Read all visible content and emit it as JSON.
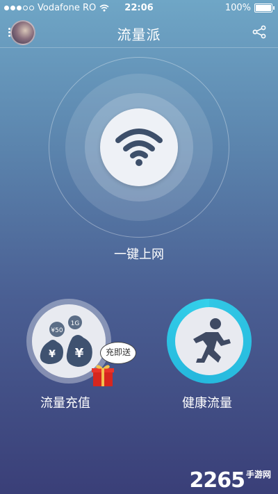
{
  "status": {
    "carrier": "Vodafone RO",
    "time": "22:06",
    "battery": "100%"
  },
  "nav": {
    "title": "流量派"
  },
  "main": {
    "connect_label": "一键上网",
    "recharge_label": "流量充值",
    "health_label": "健康流量",
    "bubble_text": "充即送",
    "bag1": "¥50",
    "bag2": "1G",
    "bag_symbol1": "¥",
    "bag_symbol2": "¥"
  },
  "watermark": {
    "number": "2265",
    "suffix": "手游网"
  },
  "colors": {
    "accent": "#31c7e5",
    "bg_top": "#6fa6c6",
    "bg_bottom": "#3a3f78"
  }
}
